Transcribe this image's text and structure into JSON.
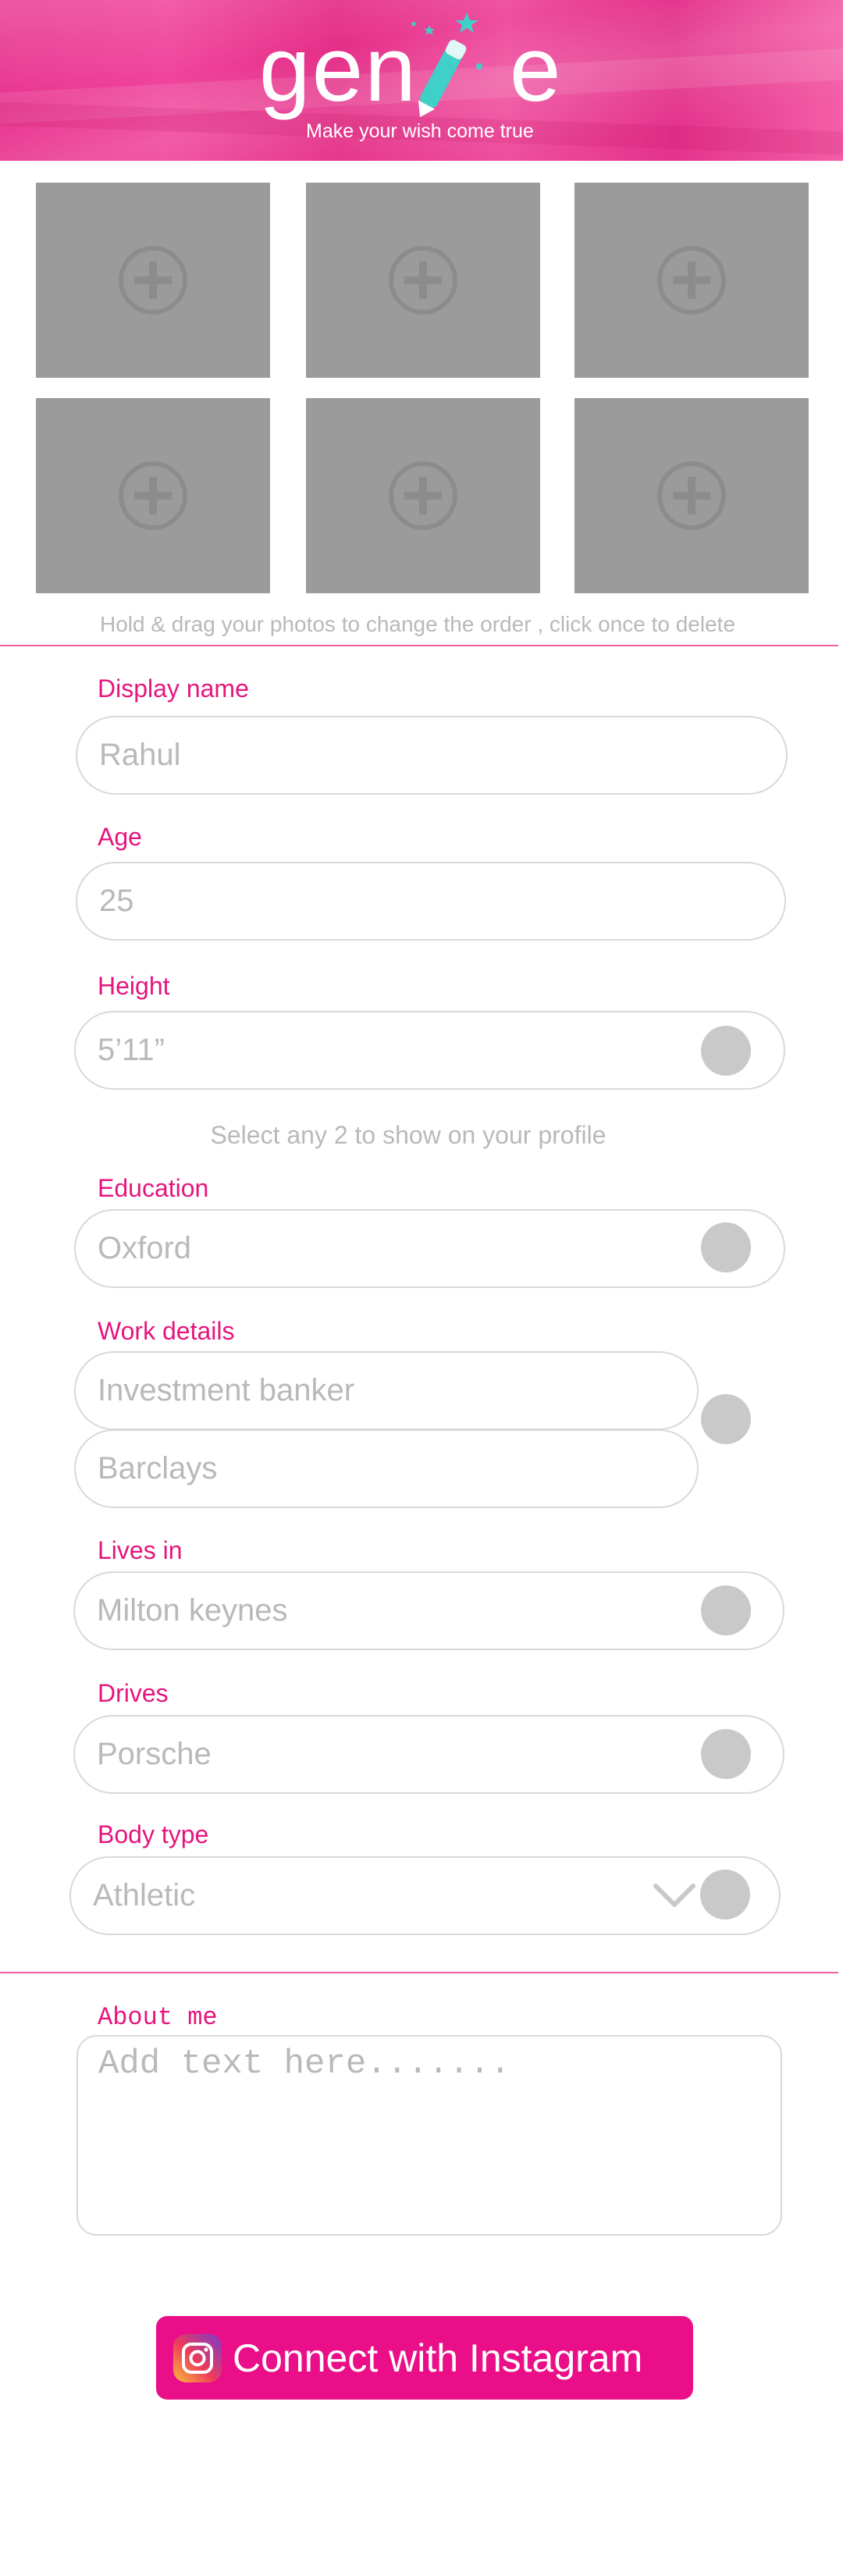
{
  "header": {
    "logo_start": "gen",
    "logo_end": "e",
    "tagline": "Make your wish come true"
  },
  "photos": {
    "hint": "Hold & drag your photos to change the order , click once to delete"
  },
  "profile": {
    "display_name": {
      "label": "Display name",
      "value": "Rahul"
    },
    "age": {
      "label": "Age",
      "value": "25"
    },
    "height": {
      "label": "Height",
      "value": "5’11”"
    },
    "select_note": "Select any 2 to show on your profile",
    "education": {
      "label": "Education",
      "value": "Oxford"
    },
    "work": {
      "label": "Work details",
      "title": "Investment banker",
      "company": "Barclays"
    },
    "lives_in": {
      "label": "Lives in",
      "value": "Milton keynes"
    },
    "drives": {
      "label": "Drives",
      "value": "Porsche"
    },
    "body_type": {
      "label": "Body type",
      "value": "Athletic"
    }
  },
  "about": {
    "label": "About me",
    "placeholder": "Add text here......."
  },
  "instagram": {
    "button_label": "Connect with Instagram"
  },
  "colors": {
    "accent": "#e6157e",
    "button": "#ea0e88",
    "placeholder_text": "#b9b9b9",
    "photo_slot": "#9b9b9b",
    "toggle": "#c9c9c9"
  },
  "icons": {
    "photo_add": "add-photo-icon",
    "instagram": "instagram-icon",
    "dropdown": "chevron-down-icon",
    "logo_wand": "magic-wand-icon"
  }
}
